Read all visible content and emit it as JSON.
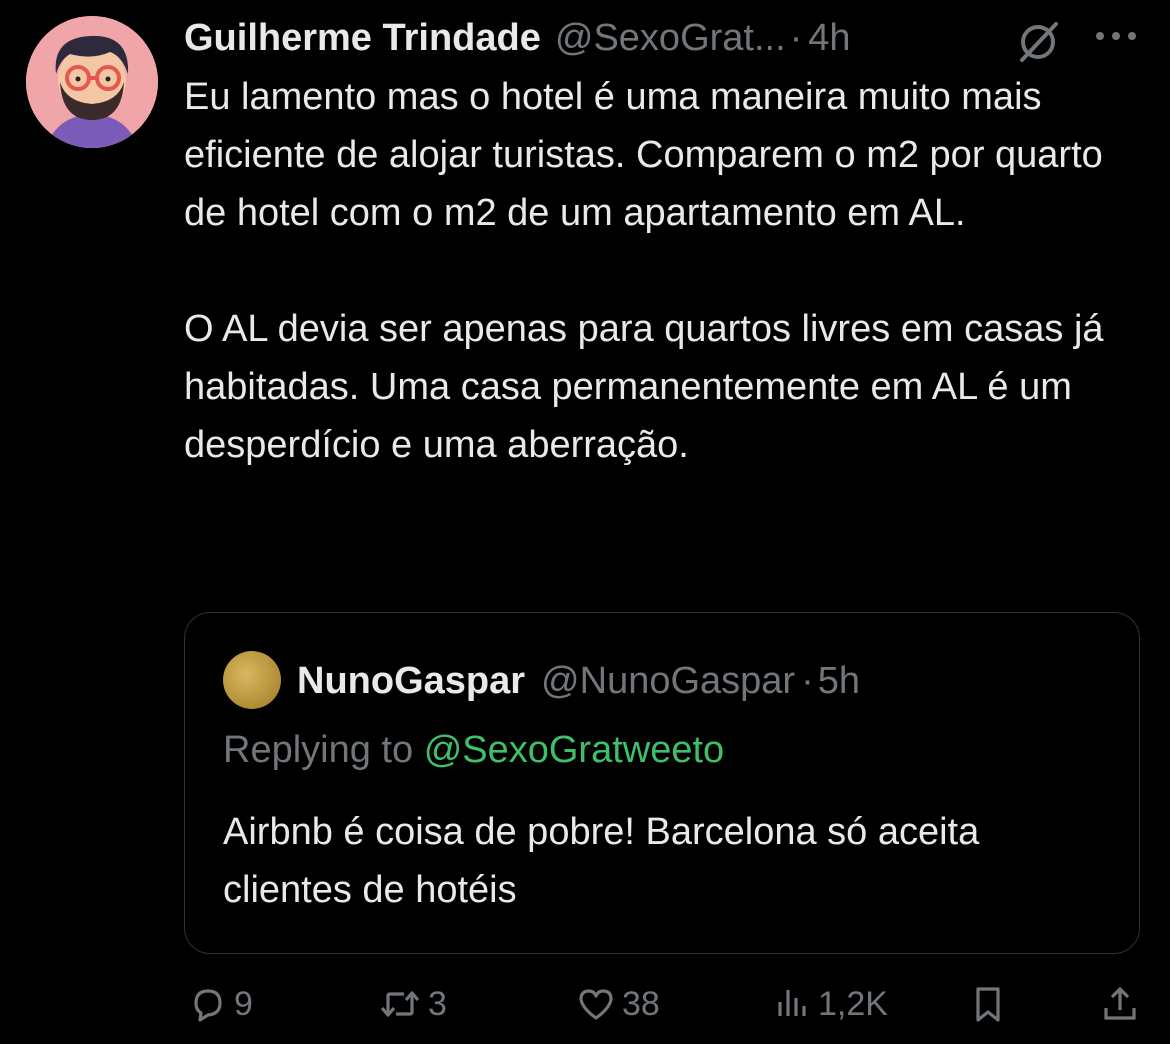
{
  "tweet": {
    "author": {
      "display_name": "Guilherme Trindade",
      "handle": "@SexoGrat...",
      "time": "4h"
    },
    "separator": "·",
    "body": {
      "paragraph1": "Eu lamento mas o hotel é uma maneira muito mais eficiente de alojar turistas.  Comparem o m2 por quarto de hotel com o m2 de um apartamento em AL.",
      "paragraph2": "O AL devia ser apenas para quartos livres em casas já habitadas. Uma casa permanentemente em AL é um desperdício e uma aberração."
    },
    "quoted": {
      "display_name": "NunoGaspar",
      "handle": "@NunoGaspar",
      "time": "5h",
      "replying_prefix": "Replying to",
      "replying_to": "@SexoGratweeto",
      "text": "Airbnb é coisa de pobre! Barcelona só aceita clientes de hotéis"
    },
    "actions": {
      "replies": "9",
      "retweets": "3",
      "likes": "38",
      "views": "1,2K"
    }
  },
  "icons": {
    "grok": "grok-icon",
    "more": "more-icon",
    "reply": "reply-icon",
    "retweet": "retweet-icon",
    "like": "heart-icon",
    "views": "views-icon",
    "bookmark": "bookmark-icon",
    "share": "share-icon"
  },
  "colors": {
    "background": "#000000",
    "text": "#e7e9ea",
    "muted": "#71767b",
    "mention": "#3fbf6a",
    "border": "#2f3336"
  }
}
